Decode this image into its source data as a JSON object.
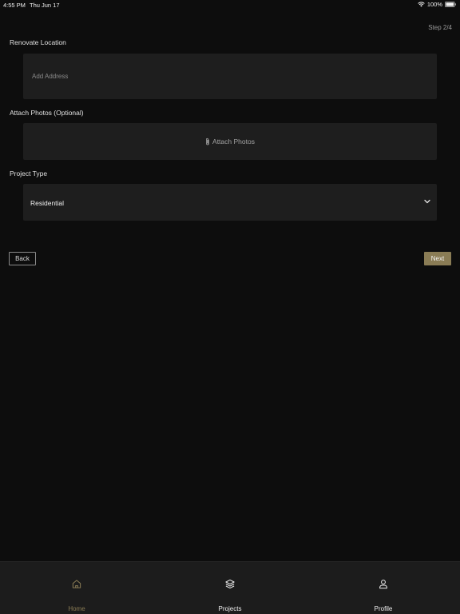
{
  "status_bar": {
    "time": "4:55 PM",
    "date": "Thu Jun 17",
    "battery": "100%"
  },
  "step": "Step 2/4",
  "location": {
    "label": "Renovate Location",
    "placeholder": "Add Address",
    "value": ""
  },
  "photos": {
    "label": "Attach Photos (Optional)",
    "button_label": "Attach Photos",
    "icon": "paperclip-icon"
  },
  "project_type": {
    "label": "Project Type",
    "selected": "Residential",
    "icon": "chevron-down-icon"
  },
  "nav_buttons": {
    "back": "Back",
    "next": "Next"
  },
  "tabs": [
    {
      "label": "Home",
      "icon": "home-icon",
      "active": true
    },
    {
      "label": "Projects",
      "icon": "layers-icon",
      "active": false
    },
    {
      "label": "Profile",
      "icon": "user-icon",
      "active": false
    }
  ],
  "colors": {
    "background": "#0d0d0d",
    "field": "#1e1e1e",
    "accent": "#8a7c55",
    "tab_bar": "#1c1c1c"
  }
}
